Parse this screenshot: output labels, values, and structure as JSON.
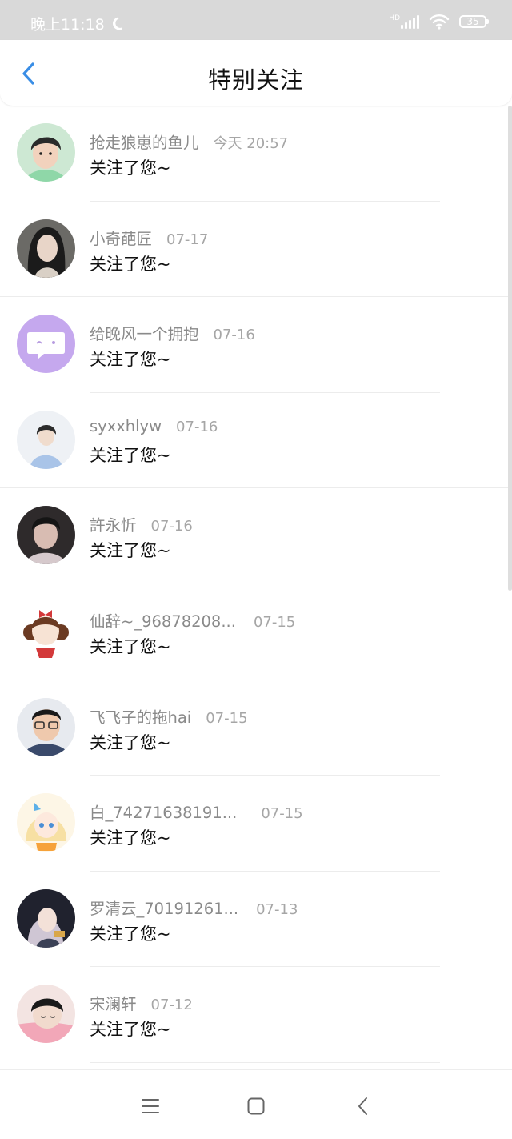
{
  "status_bar": {
    "time": "晚上11:18",
    "hd": "HD",
    "battery": "35"
  },
  "header": {
    "title": "特别关注"
  },
  "items": [
    {
      "name": "抢走狼崽的鱼儿",
      "time": "今天 20:57",
      "message": "关注了您~",
      "avatar": "photo-boy-green"
    },
    {
      "name": "小奇葩匠",
      "time": "07-17",
      "message": "关注了您~",
      "avatar": "photo-girl-dark"
    },
    {
      "name": "给晚风一个拥抱",
      "time": "07-16",
      "message": "关注了您~",
      "avatar": "purple-chat-default"
    },
    {
      "name": "syxxhlyw",
      "time": "07-16",
      "message": "关注了您~",
      "avatar": "photo-person-blue"
    },
    {
      "name": "許永忻",
      "time": "07-16",
      "message": "关注了您~",
      "avatar": "photo-man-dark"
    },
    {
      "name": "仙辞~_96878208...",
      "time": "07-15",
      "message": "关注了您~",
      "avatar": "cartoon-girl-bow"
    },
    {
      "name": "飞飞子的拖hai",
      "time": "07-15",
      "message": "关注了您~",
      "avatar": "photo-man-glasses"
    },
    {
      "name": "白_74271638191...",
      "time": "07-15",
      "message": "关注了您~",
      "avatar": "anime-girl-blonde"
    },
    {
      "name": "罗清云_70191261...",
      "time": "07-13",
      "message": "关注了您~",
      "avatar": "anime-girl-silver"
    },
    {
      "name": "宋澜轩",
      "time": "07-12",
      "message": "关注了您~",
      "avatar": "photo-boy-pink"
    }
  ],
  "colors": {
    "accent": "#3a8ee6",
    "name_gray": "#8a8a8a",
    "time_gray": "#a6a6a6"
  }
}
